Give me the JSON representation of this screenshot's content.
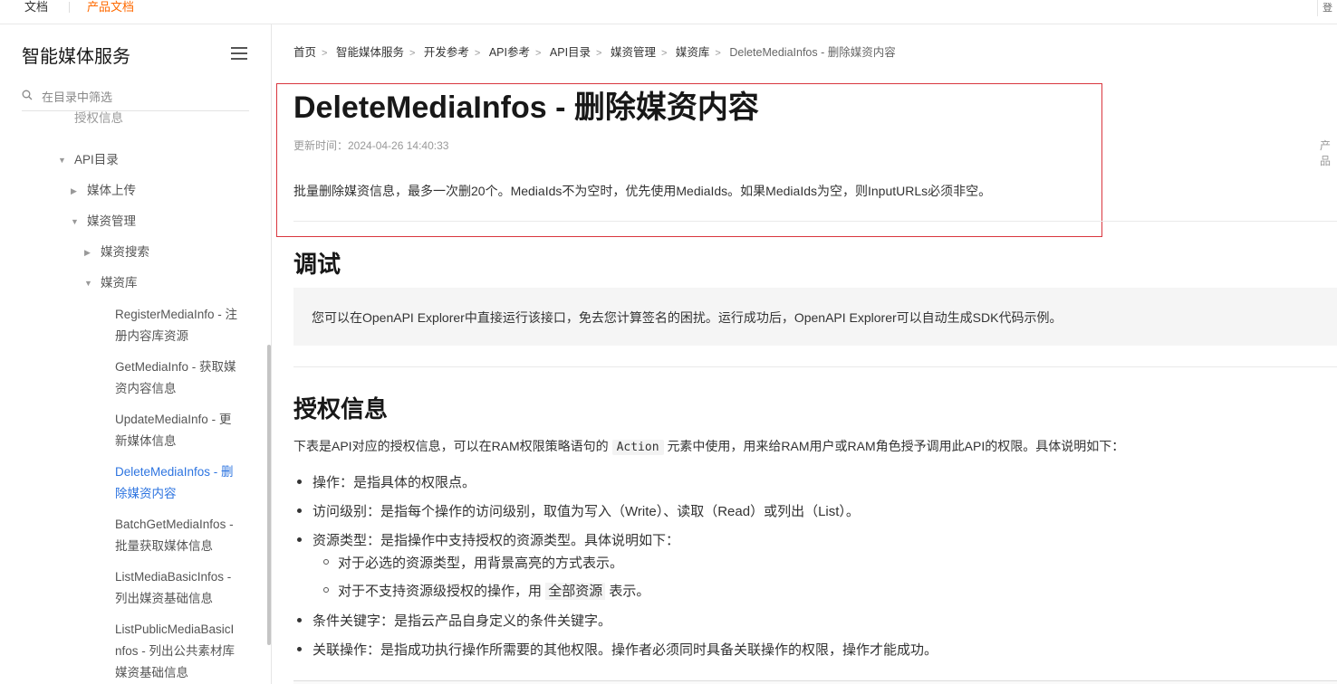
{
  "topbar": {
    "docs": "文档",
    "product_docs": "产品文档",
    "corner": "登"
  },
  "sidebar": {
    "title": "智能媒体服务",
    "search_placeholder": "在目录中筛选",
    "items": [
      {
        "label": "授权信息",
        "level": 3,
        "arrow": ""
      },
      {
        "label": "API目录",
        "level": 2,
        "arrow": "▼"
      },
      {
        "label": "媒体上传",
        "level": 3,
        "arrow": "▶"
      },
      {
        "label": "媒资管理",
        "level": 3,
        "arrow": "▼"
      },
      {
        "label": "媒资搜索",
        "level": 4,
        "arrow": "▶"
      },
      {
        "label": "媒资库",
        "level": 4,
        "arrow": "▼"
      },
      {
        "label": "RegisterMediaInfo - 注册内容库资源",
        "level": 5
      },
      {
        "label": "GetMediaInfo - 获取媒资内容信息",
        "level": 5
      },
      {
        "label": "UpdateMediaInfo - 更新媒体信息",
        "level": 5
      },
      {
        "label": "DeleteMediaInfos - 删除媒资内容",
        "level": 5,
        "active": true
      },
      {
        "label": "BatchGetMediaInfos - 批量获取媒体信息",
        "level": 5
      },
      {
        "label": "ListMediaBasicInfos - 列出媒资基础信息",
        "level": 5
      },
      {
        "label": "ListPublicMediaBasicInfos - 列出公共素材库媒资基础信息",
        "level": 5
      }
    ]
  },
  "breadcrumb": [
    "首页",
    "智能媒体服务",
    "开发参考",
    "API参考",
    "API目录",
    "媒资管理",
    "媒资库",
    "DeleteMediaInfos - 删除媒资内容"
  ],
  "page": {
    "title": "DeleteMediaInfos - 删除媒资内容",
    "updated": "更新时间：2024-04-26 14:40:33",
    "right_cut": "产品",
    "description": "批量删除媒资信息，最多一次删20个。MediaIds不为空时，优先使用MediaIds。如果MediaIds为空，则InputURLs必须非空。"
  },
  "debug": {
    "heading": "调试",
    "tip": "您可以在OpenAPI Explorer中直接运行该接口，免去您计算签名的困扰。运行成功后，OpenAPI Explorer可以自动生成SDK代码示例。"
  },
  "auth": {
    "heading": "授权信息",
    "desc_before": "下表是API对应的授权信息，可以在RAM权限策略语句的",
    "desc_code": "Action",
    "desc_after": "元素中使用，用来给RAM用户或RAM角色授予调用此API的权限。具体说明如下：",
    "list": [
      "操作：是指具体的权限点。",
      "访问级别：是指每个操作的访问级别，取值为写入（Write）、读取（Read）或列出（List）。",
      "资源类型：是指操作中支持授权的资源类型。具体说明如下："
    ],
    "sublist_1": "对于必选的资源类型，用背景高亮的方式表示。",
    "sublist_2_before": "对于不支持资源级授权的操作，用",
    "sublist_2_code": "全部资源",
    "sublist_2_after": "表示。",
    "list_after": [
      "条件关键字：是指云产品自身定义的条件关键字。",
      "关联操作：是指成功执行操作所需要的其他权限。操作者必须同时具备关联操作的权限，操作才能成功。"
    ]
  },
  "colors": {
    "accent": "#ff6a00",
    "active_link": "#2d74e0",
    "highlight_border": "#d9363e"
  }
}
